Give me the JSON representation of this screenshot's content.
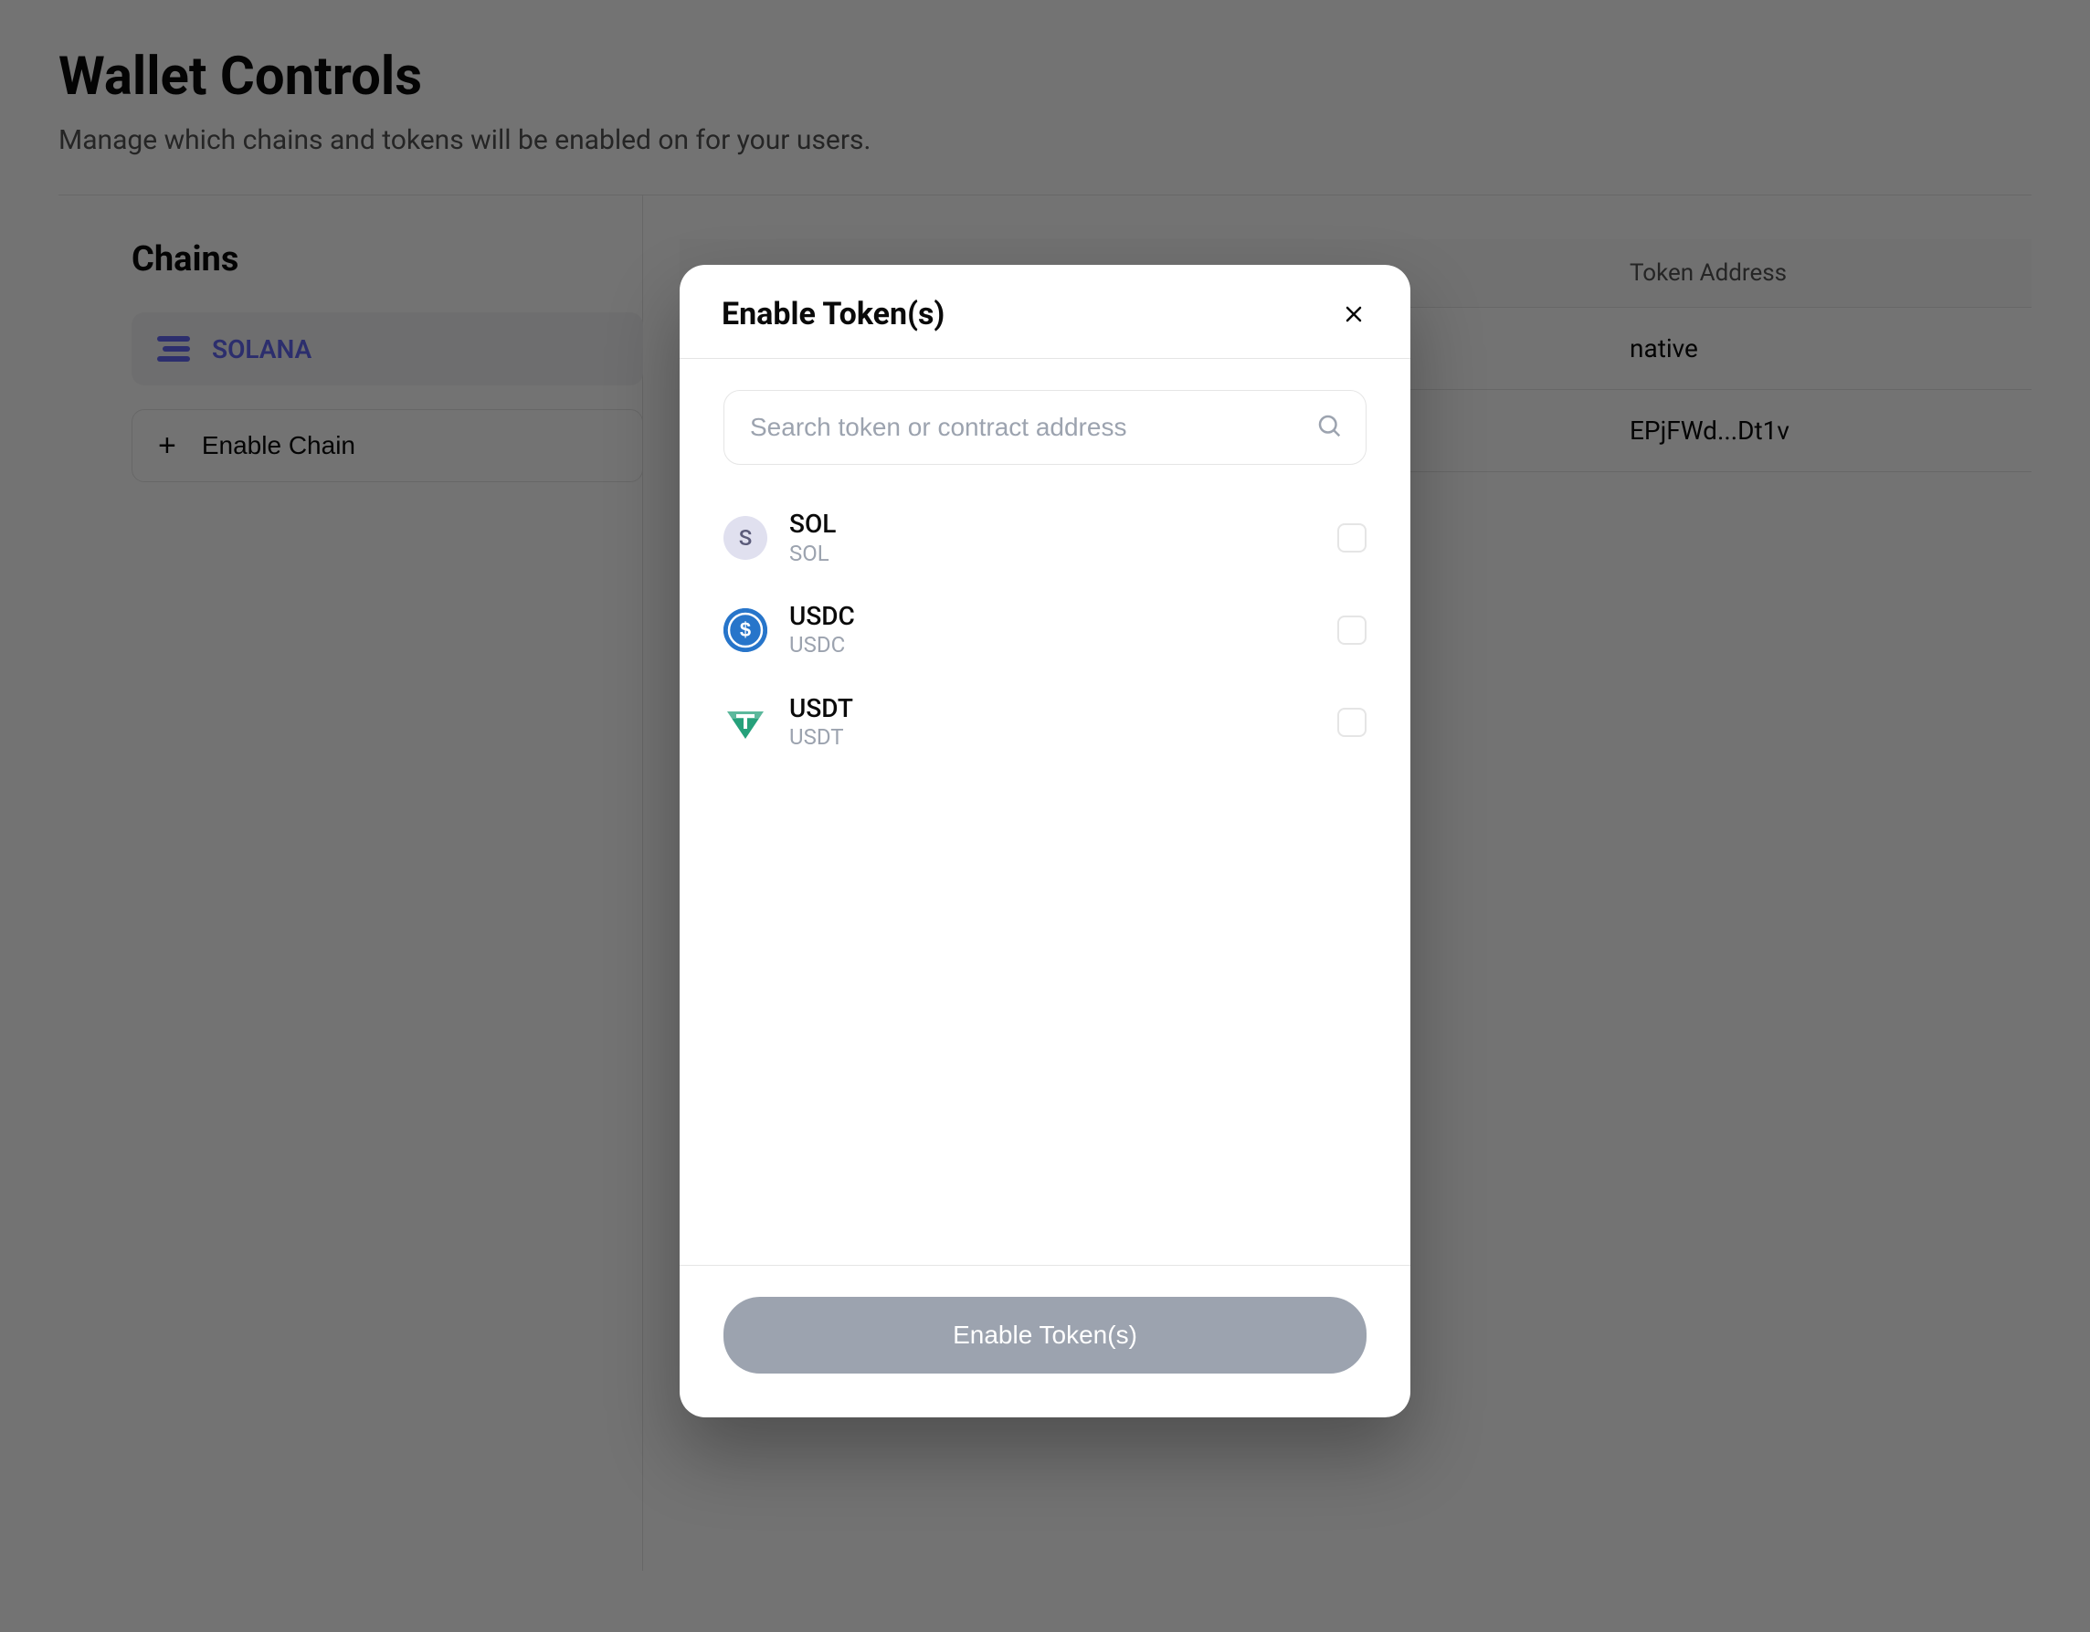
{
  "page": {
    "title": "Wallet Controls",
    "subtitle": "Manage which chains and tokens will be enabled on for your users."
  },
  "chains": {
    "heading": "Chains",
    "items": [
      {
        "name": "SOLANA"
      }
    ],
    "enable_label": "Enable Chain"
  },
  "tokens_table": {
    "header": {
      "address": "Token Address"
    },
    "rows": [
      {
        "address": "native"
      },
      {
        "address": "EPjFWd...Dt1v"
      }
    ]
  },
  "modal": {
    "title": "Enable Token(s)",
    "search_placeholder": "Search token or contract address",
    "tokens": [
      {
        "symbol": "SOL",
        "sub": "SOL",
        "letter": "S"
      },
      {
        "symbol": "USDC",
        "sub": "USDC"
      },
      {
        "symbol": "USDT",
        "sub": "USDT"
      }
    ],
    "submit_label": "Enable Token(s)"
  }
}
